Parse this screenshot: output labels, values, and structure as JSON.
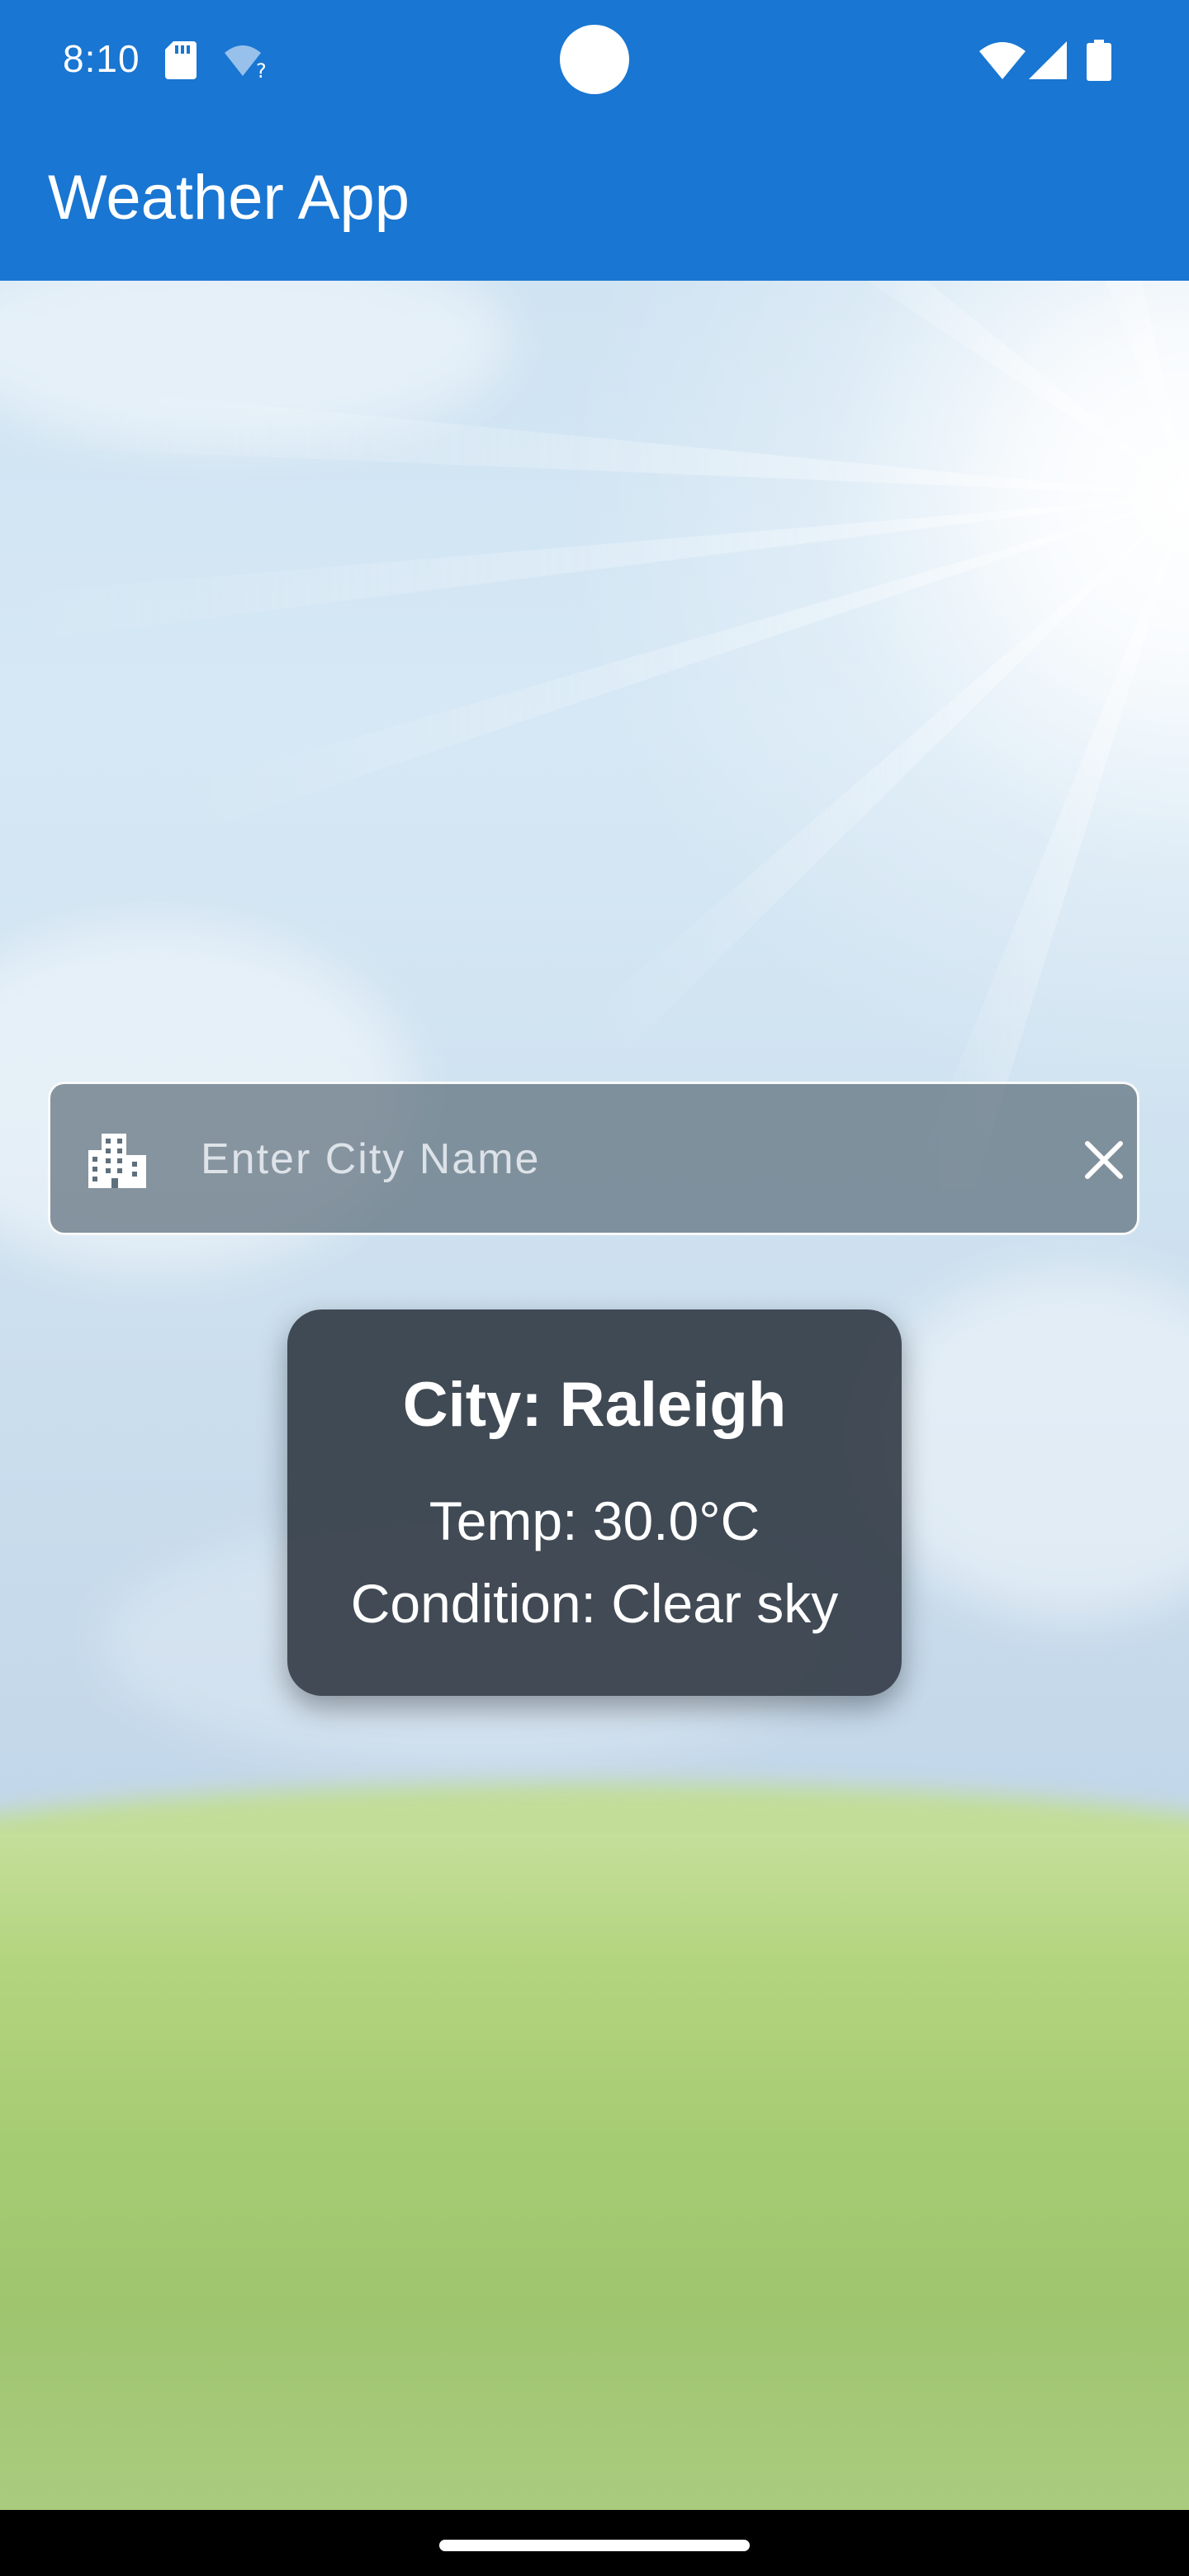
{
  "status_bar": {
    "time": "8:10",
    "icons": [
      "sd-card-icon",
      "wifi-question-icon",
      "wifi-icon",
      "signal-icon",
      "battery-icon"
    ]
  },
  "app_bar": {
    "title": "Weather App",
    "color": "#1976D2"
  },
  "search": {
    "placeholder": "Enter City Name",
    "value": "",
    "leading_icon": "city-icon",
    "trailing_icon": "close-icon"
  },
  "weather_card": {
    "city_line": "City: Raleigh",
    "temp_line": "Temp: 30.0°C",
    "condition_line": "Condition: Clear sky"
  },
  "background": {
    "scene": "sunny sky over green field",
    "sky_color": "#cfe3f2",
    "grass_color": "#a6cc73"
  }
}
